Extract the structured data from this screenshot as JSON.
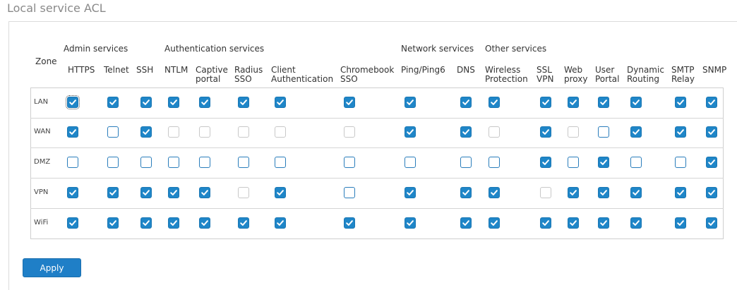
{
  "title": "Local service ACL",
  "zone_header": "Zone",
  "groups": {
    "admin": "Admin services",
    "auth": "Authentication services",
    "network": "Network services",
    "other": "Other services"
  },
  "columns": [
    "HTTPS",
    "Telnet",
    "SSH",
    "NTLM",
    "Captive\nportal",
    "Radius\nSSO",
    "Client\nAuthentication",
    "Chromebook\nSSO",
    "Ping/Ping6",
    "DNS",
    "Wireless\nProtection",
    "SSL\nVPN",
    "Web\nproxy",
    "User\nPortal",
    "Dynamic\nRouting",
    "SMTP\nRelay",
    "SNMP"
  ],
  "zones": [
    "LAN",
    "WAN",
    "DMZ",
    "VPN",
    "WiFi"
  ],
  "states": {
    "LAN": [
      1,
      1,
      1,
      1,
      1,
      1,
      1,
      1,
      1,
      1,
      1,
      1,
      1,
      1,
      1,
      1,
      1
    ],
    "WAN": [
      1,
      0,
      1,
      2,
      2,
      2,
      2,
      2,
      1,
      1,
      2,
      1,
      2,
      0,
      1,
      1,
      1
    ],
    "DMZ": [
      0,
      0,
      0,
      0,
      0,
      0,
      0,
      0,
      0,
      0,
      0,
      1,
      0,
      1,
      0,
      0,
      1
    ],
    "VPN": [
      1,
      1,
      1,
      1,
      1,
      2,
      1,
      0,
      1,
      1,
      1,
      2,
      1,
      1,
      1,
      1,
      1
    ],
    "WiFi": [
      1,
      1,
      1,
      1,
      1,
      1,
      1,
      1,
      1,
      1,
      1,
      1,
      1,
      1,
      1,
      1,
      1
    ]
  },
  "state_legend": {
    "0": "unchecked",
    "1": "checked",
    "2": "disabled"
  },
  "apply_label": "Apply",
  "colors": {
    "accent": "#1f86c8",
    "grid_border": "#cfcfcf"
  }
}
